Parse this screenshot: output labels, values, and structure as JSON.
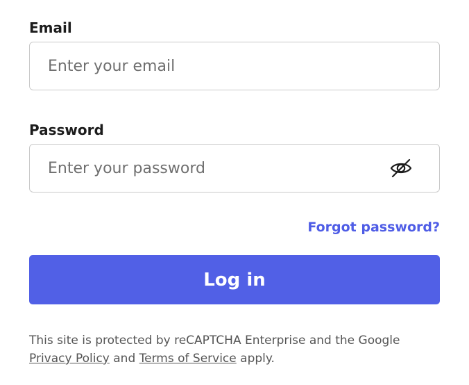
{
  "email": {
    "label": "Email",
    "placeholder": "Enter your email",
    "value": ""
  },
  "password": {
    "label": "Password",
    "placeholder": "Enter your password",
    "value": "",
    "toggle_icon": "eye-slash-icon"
  },
  "forgot_password": {
    "label": "Forgot password?"
  },
  "login_button": {
    "label": "Log in"
  },
  "recaptcha": {
    "text_before": "This site is protected by reCAPTCHA Enterprise and the Google ",
    "privacy_link": "Privacy Policy",
    "text_middle": " and ",
    "terms_link": "Terms of Service",
    "text_after": " apply."
  },
  "colors": {
    "accent": "#5160e6",
    "link": "#4f5de6",
    "border": "#c9c9c9",
    "muted_text": "#555555"
  }
}
